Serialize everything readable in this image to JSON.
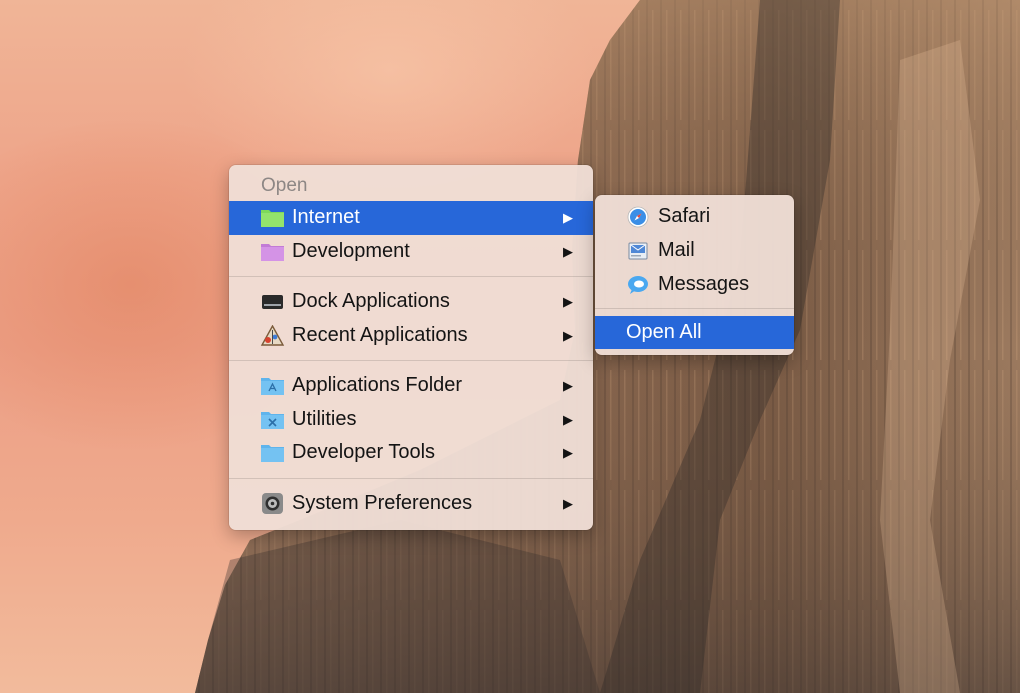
{
  "menu": {
    "header": "Open",
    "groups": [
      [
        {
          "label": "Internet",
          "icon": "folder-green-icon",
          "highlighted": true
        },
        {
          "label": "Development",
          "icon": "folder-purple-icon"
        }
      ],
      [
        {
          "label": "Dock Applications",
          "icon": "dock-icon"
        },
        {
          "label": "Recent Applications",
          "icon": "recent-apps-icon"
        }
      ],
      [
        {
          "label": "Applications Folder",
          "icon": "applications-folder-icon"
        },
        {
          "label": "Utilities",
          "icon": "utilities-folder-icon"
        },
        {
          "label": "Developer Tools",
          "icon": "folder-blue-icon"
        }
      ],
      [
        {
          "label": "System Preferences",
          "icon": "system-preferences-icon"
        }
      ]
    ],
    "submenu_arrow": "▶"
  },
  "submenu": {
    "items": [
      {
        "label": "Safari",
        "icon": "safari-icon"
      },
      {
        "label": "Mail",
        "icon": "mail-icon"
      },
      {
        "label": "Messages",
        "icon": "messages-icon"
      }
    ],
    "open_all": "Open All"
  },
  "colors": {
    "highlight": "#2767d9",
    "menu_background": "#efded5",
    "header_text": "#8d8785",
    "desktop_sky": "#ee a58a"
  }
}
